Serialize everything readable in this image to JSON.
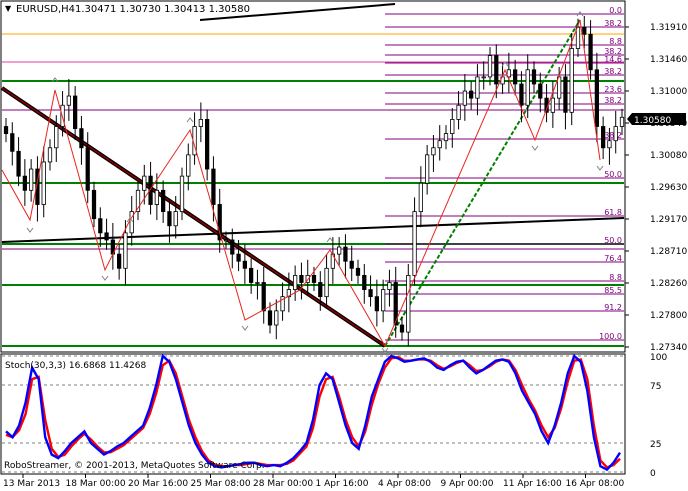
{
  "main_header": {
    "label": "EURUSD,H4",
    "values": "1.30471 1.30730 1.30413 1.30580"
  },
  "price_axis": {
    "ticks": [
      "1.31910",
      "1.31460",
      "1.31000",
      "1.30540",
      "1.30080",
      "1.29630",
      "1.29170",
      "1.28710",
      "1.28260",
      "1.27800",
      "1.27340"
    ],
    "current_price": "1.30580"
  },
  "fib_labels_right": [
    "0.0",
    "38.2",
    "8.8",
    "38.2",
    "14.6",
    "38.2",
    "23.6",
    "38.2",
    "38.2",
    "50.0",
    "61.8",
    "50.0",
    "76.4",
    "8.8",
    "85.5",
    "91.2",
    "100.0"
  ],
  "stoch": {
    "label": "Stoch(30,3,3) 16.6868 11.4268",
    "ticks": [
      "100",
      "75",
      "25",
      "0"
    ]
  },
  "time_axis": {
    "labels": [
      "13 Mar 2013",
      "18 Mar 00:00",
      "20 Mar 16:00",
      "25 Mar 08:00",
      "28 Mar 00:00",
      "1 Apr 16:00",
      "4 Apr 08:00",
      "9 Apr 00:00",
      "11 Apr 16:00",
      "16 Apr 08:00"
    ]
  },
  "watermark": "RoboStreamer, © 2001-2013, MetaQuotes Software Corp.",
  "colors": {
    "background": "#ffffff",
    "bull_candle": "#ffffff",
    "bear_candle": "#000000",
    "zigzag": "#e8251e",
    "support_green": "#008000",
    "fib_purple": "#800080",
    "fib_pink": "#e040a0",
    "fib_orange": "#ffa500",
    "stoch_main": "#0000ff",
    "stoch_signal": "#ff0000"
  },
  "chart_data": {
    "type": "candlestick",
    "symbol": "EURUSD",
    "timeframe": "H4",
    "ohlc_last": {
      "open": 1.30471,
      "high": 1.3073,
      "low": 1.30413,
      "close": 1.3058
    },
    "y_range": [
      1.2734,
      1.3191
    ],
    "close_path": [
      1.3035,
      1.301,
      1.2975,
      1.2955,
      1.2985,
      1.2935,
      1.2995,
      1.3015,
      1.3045,
      1.3075,
      1.3088,
      1.3042,
      1.3015,
      1.2955,
      1.2915,
      1.2895,
      1.2885,
      1.2865,
      1.2845,
      1.2895,
      1.2925,
      1.2955,
      1.2975,
      1.2935,
      1.2955,
      1.2925,
      1.2905,
      1.2925,
      1.2975,
      1.3005,
      1.3045,
      1.3055,
      1.2985,
      1.2935,
      1.2885,
      1.2885,
      1.2865,
      1.2855,
      1.2845,
      1.2825,
      1.2825,
      1.2785,
      1.2765,
      1.2785,
      1.2805,
      1.2815,
      1.2835,
      1.2825,
      1.2835,
      1.2825,
      1.2805,
      1.2845,
      1.2865,
      1.2875,
      1.2855,
      1.2845,
      1.2835,
      1.2815,
      1.2805,
      1.2785,
      1.2815,
      1.2825,
      1.2765,
      1.2755,
      1.2835,
      1.2925,
      1.2965,
      1.3005,
      1.3015,
      1.3025,
      1.3035,
      1.3055,
      1.3075,
      1.3095,
      1.3085,
      1.3115,
      1.3115,
      1.3145,
      1.3105,
      1.3115,
      1.3125,
      1.3105,
      1.3075,
      1.3125,
      1.3105,
      1.3085,
      1.3065,
      1.3085,
      1.3115,
      1.3065,
      1.3155,
      1.3185,
      1.3175,
      1.3125,
      1.3045,
      1.3015,
      1.3025,
      1.3045,
      1.3058
    ],
    "stoch_main": [
      35,
      30,
      40,
      60,
      90,
      80,
      30,
      15,
      12,
      18,
      25,
      30,
      35,
      25,
      20,
      15,
      18,
      22,
      25,
      30,
      35,
      40,
      55,
      75,
      100,
      95,
      80,
      60,
      40,
      25,
      15,
      8,
      5,
      4,
      5,
      6,
      7,
      8,
      8,
      6,
      5,
      6,
      5,
      8,
      12,
      18,
      25,
      45,
      75,
      85,
      80,
      60,
      40,
      25,
      20,
      40,
      65,
      80,
      95,
      100,
      98,
      95,
      96,
      97,
      98,
      95,
      90,
      88,
      92,
      95,
      96,
      90,
      85,
      88,
      92,
      96,
      97,
      95,
      85,
      70,
      60,
      50,
      35,
      25,
      40,
      60,
      85,
      100,
      95,
      70,
      30,
      5,
      2,
      8,
      16.69
    ],
    "stoch_signal": [
      32,
      30,
      36,
      50,
      80,
      82,
      45,
      20,
      13,
      15,
      22,
      28,
      33,
      28,
      22,
      17,
      17,
      20,
      23,
      28,
      33,
      38,
      50,
      68,
      92,
      96,
      85,
      65,
      45,
      30,
      18,
      10,
      6,
      5,
      5,
      6,
      6,
      7,
      8,
      7,
      6,
      6,
      6,
      7,
      10,
      16,
      22,
      38,
      65,
      80,
      82,
      65,
      45,
      30,
      22,
      35,
      58,
      76,
      90,
      98,
      99,
      96,
      96,
      97,
      97,
      96,
      92,
      89,
      91,
      94,
      96,
      92,
      87,
      88,
      91,
      95,
      97,
      96,
      88,
      75,
      63,
      53,
      40,
      30,
      38,
      55,
      78,
      96,
      97,
      80,
      40,
      10,
      4,
      6,
      11.43
    ]
  }
}
